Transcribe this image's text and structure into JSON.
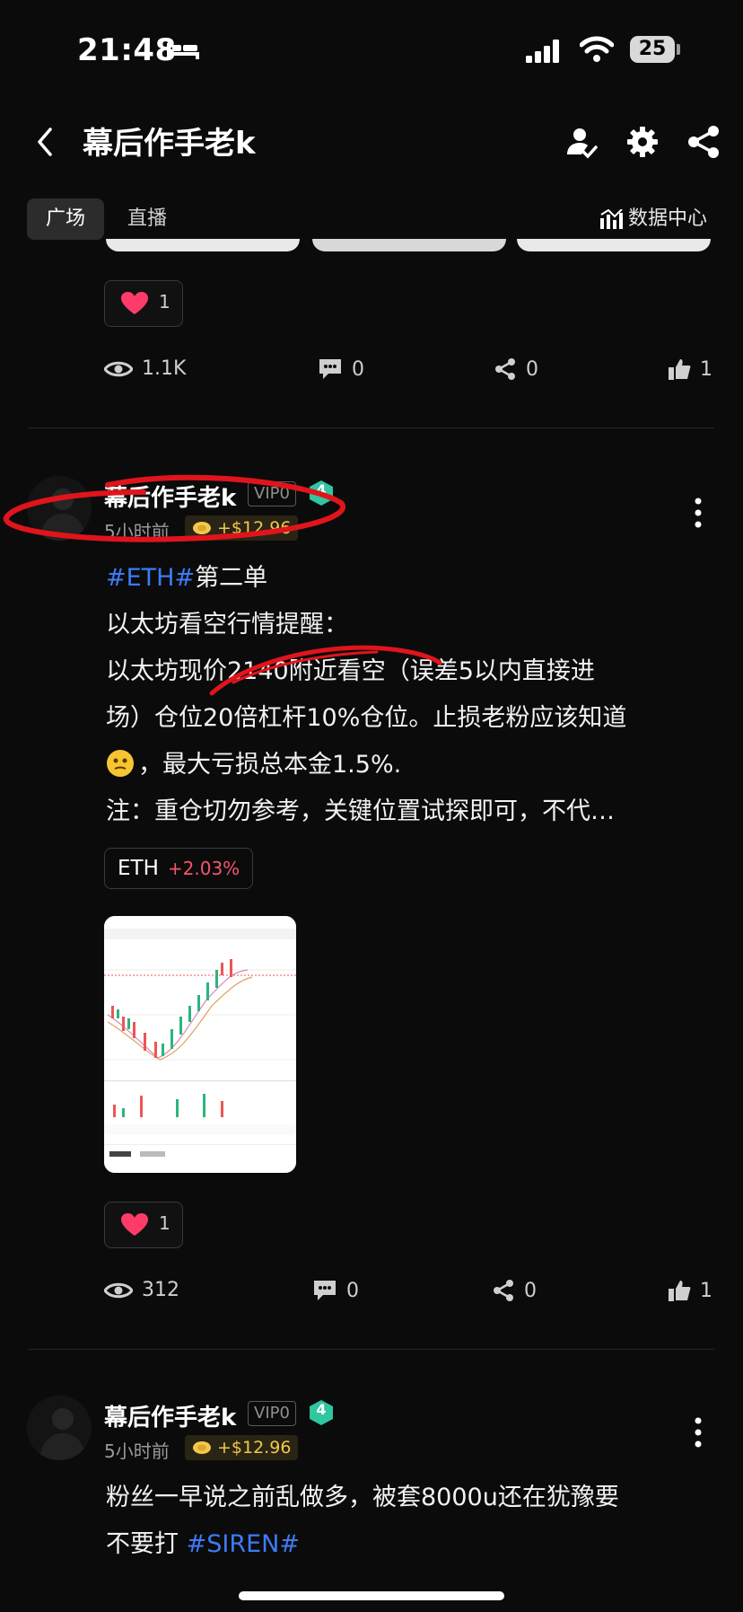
{
  "status_bar": {
    "time": "21:48",
    "battery": "25"
  },
  "header": {
    "title": "幕后作手老k"
  },
  "tabs": {
    "active": "广场",
    "other": "直播",
    "data_center": "数据中心"
  },
  "post_prev": {
    "likes": "1",
    "views": "1.1K",
    "comments": "0",
    "shares": "0",
    "thumbs": "1"
  },
  "post1": {
    "username": "幕后作手老k",
    "vip": "VIP0",
    "level": "4",
    "time_ago": "5小时前",
    "tip": "+$12.96",
    "hashtag": "#ETH#",
    "line1_rest": "第二单",
    "line2": " 以太坊看空行情提醒：",
    "line3": "以太坊现价2140附近看空（误差5以内直接进",
    "line4": "场）仓位20倍杠杆10%仓位。止损老粉应该知道",
    "line5": "，最大亏损总本金1.5%.",
    "line6": "注：重仓切勿参考，关键位置试探即可，不代…",
    "ticker": "ETH",
    "ticker_change": "+2.03%",
    "likes": "1",
    "views": "312",
    "comments": "0",
    "shares": "0",
    "thumbs": "1"
  },
  "post2": {
    "username": "幕后作手老k",
    "vip": "VIP0",
    "level": "4",
    "time_ago": "5小时前",
    "tip": "+$12.96",
    "text1": "粉丝一早说之前乱做多，被套8000u还在犹豫要",
    "text2": "不要打 ",
    "hashtag": "#SIREN#"
  },
  "colors": {
    "accent_blue": "#3d7bf7",
    "heart_pink": "#ff3b6a",
    "scribble_red": "#e0141c",
    "up_red": "#f5556d",
    "level_green": "#2fc6a0",
    "tip_gold": "#f2c94c"
  }
}
